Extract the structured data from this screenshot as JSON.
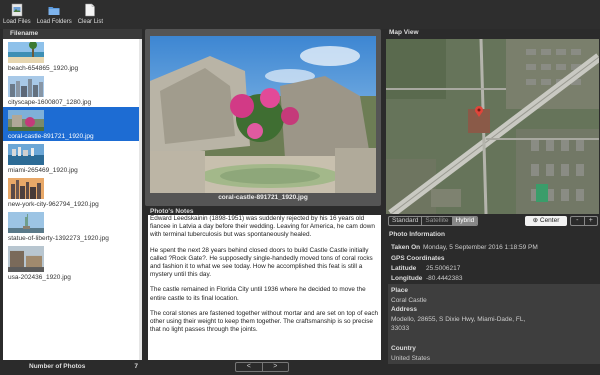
{
  "toolbar": {
    "load_files": "Load Files",
    "load_folders": "Load Folders",
    "clear_list": "Clear List"
  },
  "file_list": {
    "header": "Filename",
    "items": [
      {
        "name": "beach-654865_1920.jpg",
        "selected": false
      },
      {
        "name": "cityscape-1600807_1280.jpg",
        "selected": false
      },
      {
        "name": "coral-castle-891721_1920.jpg",
        "selected": true
      },
      {
        "name": "miami-265469_1920.jpg",
        "selected": false
      },
      {
        "name": "new-york-city-962794_1920.jpg",
        "selected": false
      },
      {
        "name": "statue-of-liberty-1392273_1920.jpg",
        "selected": false
      },
      {
        "name": "usa-202436_1920.jpg",
        "selected": false
      }
    ],
    "footer_label": "Number of Photos",
    "footer_count": "7"
  },
  "photo": {
    "caption": "coral-castle-891721_1920.jpg"
  },
  "notes": {
    "header": "Photo's Notes",
    "paragraphs": [
      "Edward Leedskainin (1898-1951) was suddenly rejected by his 16 years old fiancee  in Latvia a day before their wedding. Leaving for America, he cam down with terminal tuberculosis but was spontaneously healed.",
      "He spent the next 28 years behind closed doors to build Castle Castle initially called ?Rock Gate?. He supposedly single-handedly moved tons of coral rocks and fashion it to what we see today. How he accomplished this feat is still a mystery until this day.",
      "The castle remained in Florida City until 1936 where he decided to move the entire castle to its final location.",
      "The coral stones are fastened together without mortar and are set on top of each other using their weight to keep them together. The craftsmanship is so precise that no light passes through the joints."
    ],
    "prev": "<",
    "next": ">"
  },
  "map": {
    "header": "Map View",
    "modes": [
      "Standard",
      "Satellite",
      "Hybrid"
    ],
    "active_mode": "Hybrid",
    "center_label": "Center",
    "zoom_out": "-",
    "zoom_in": "+"
  },
  "info": {
    "header": "Photo Information",
    "taken_on_label": "Taken On",
    "taken_on_value": "Monday, 5 September 2016 1:18:59 PM",
    "gps_label": "GPS Coordinates",
    "latitude_label": "Latitude",
    "latitude_value": "25.5006217",
    "longitude_label": "Longitude",
    "longitude_value": "-80.4442383",
    "place_label": "Place",
    "place_value": "Coral Castle",
    "address_label": "Address",
    "address_value_1": "Modello, 28655, S Dixie Hwy, Miami-Dade, FL,",
    "address_value_2": "33033",
    "country_label": "Country",
    "country_value": "United States"
  },
  "colors": {
    "selection": "#1d6cd3",
    "background": "#2b2b2b"
  }
}
